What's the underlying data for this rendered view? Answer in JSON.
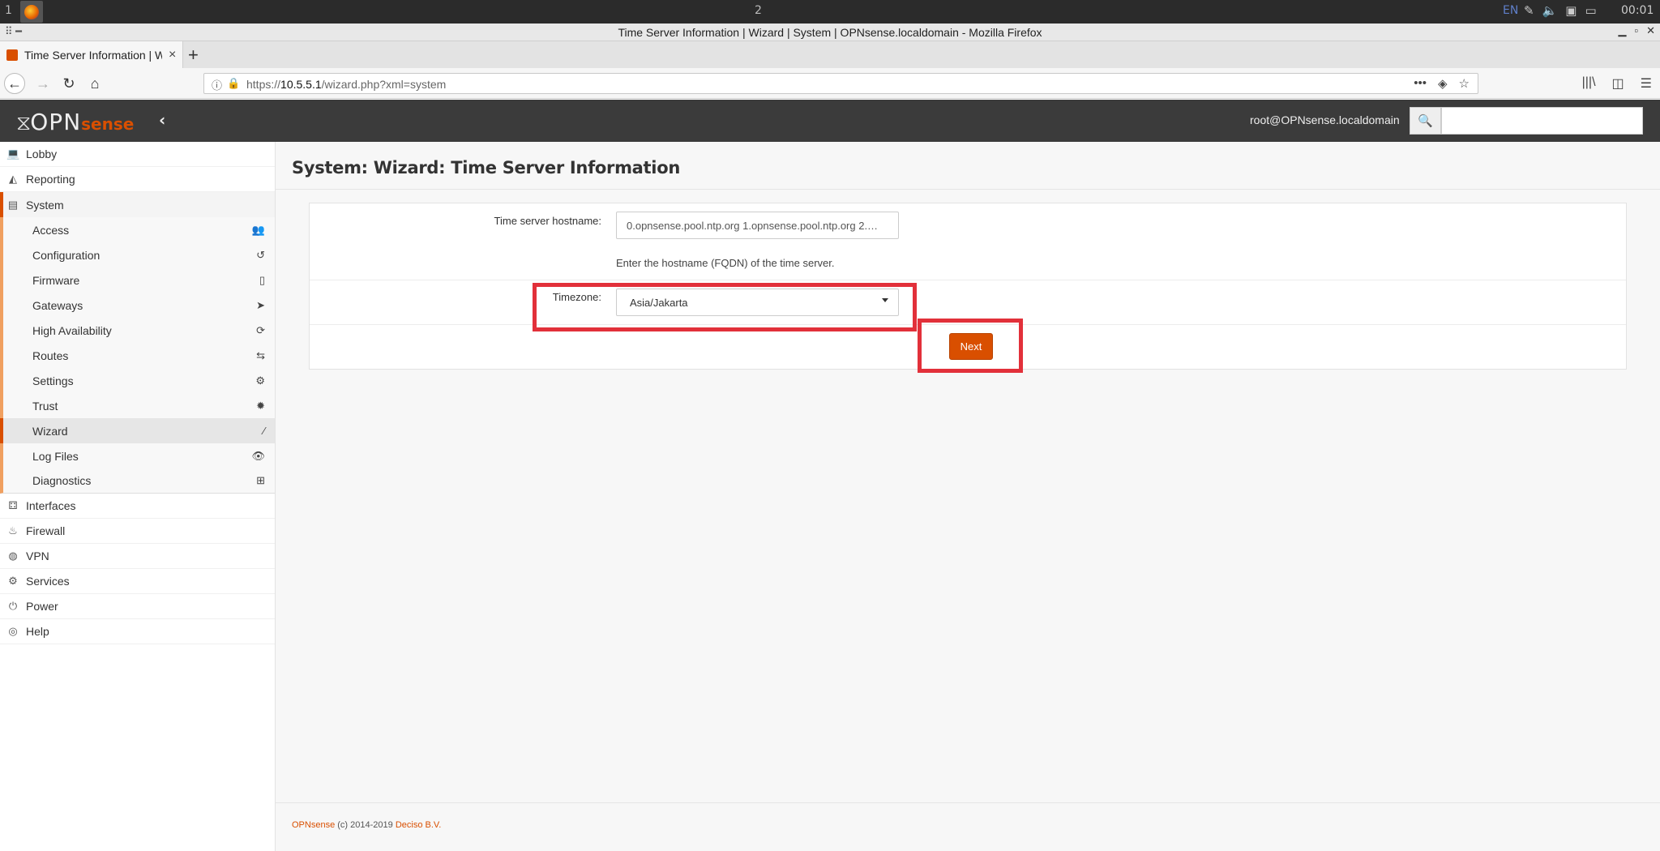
{
  "os": {
    "workspace1": "1",
    "workspace2": "2",
    "lang": "EN",
    "clock": "00:01"
  },
  "window": {
    "title": "Time Server Information | Wizard | System | OPNsense.localdomain - Mozilla Firefox"
  },
  "tab": {
    "title": "Time Server Information | W",
    "close": "×",
    "new": "+"
  },
  "nav": {
    "url_prefix": "https://",
    "url_host": "10.5.5.1",
    "url_path": "/wizard.php?xml=system"
  },
  "header": {
    "logo_opn": "OPN",
    "logo_sense": "sense",
    "user": "root@OPNsense.localdomain",
    "search_placeholder": ""
  },
  "sidebar": {
    "top": [
      {
        "label": "Lobby",
        "icon": "laptop-icon"
      },
      {
        "label": "Reporting",
        "icon": "area-chart-icon"
      }
    ],
    "system": {
      "label": "System",
      "icon": "server-icon"
    },
    "system_items": [
      {
        "label": "Access",
        "icon": "users-icon"
      },
      {
        "label": "Configuration",
        "icon": "history-icon"
      },
      {
        "label": "Firmware",
        "icon": "tablet-icon"
      },
      {
        "label": "Gateways",
        "icon": "location-arrow-icon"
      },
      {
        "label": "High Availability",
        "icon": "refresh-icon"
      },
      {
        "label": "Routes",
        "icon": "map-signs-icon"
      },
      {
        "label": "Settings",
        "icon": "cogs-icon"
      },
      {
        "label": "Trust",
        "icon": "certificate-icon"
      },
      {
        "label": "Wizard",
        "icon": "magic-icon"
      },
      {
        "label": "Log Files",
        "icon": "eye-icon"
      },
      {
        "label": "Diagnostics",
        "icon": "medkit-icon"
      }
    ],
    "bottom": [
      {
        "label": "Interfaces",
        "icon": "sitemap-icon"
      },
      {
        "label": "Firewall",
        "icon": "fire-icon"
      },
      {
        "label": "VPN",
        "icon": "globe-icon"
      },
      {
        "label": "Services",
        "icon": "cog-icon"
      },
      {
        "label": "Power",
        "icon": "plug-icon"
      },
      {
        "label": "Help",
        "icon": "life-ring-icon"
      }
    ]
  },
  "main": {
    "title": "System: Wizard: Time Server Information",
    "hostname_label": "Time server hostname:",
    "hostname_value": "0.opnsense.pool.ntp.org 1.opnsense.pool.ntp.org 2.…",
    "hostname_help": "Enter the hostname (FQDN) of the time server.",
    "timezone_label": "Timezone:",
    "timezone_value": "Asia/Jakarta",
    "next_label": "Next"
  },
  "footer": {
    "org": "OPNsense",
    "copy": " (c) 2014-2019 ",
    "company": "Deciso B.V."
  },
  "colors": {
    "accent": "#d94f00",
    "highlight": "#e2303a",
    "header_bg": "#3b3b3b"
  }
}
